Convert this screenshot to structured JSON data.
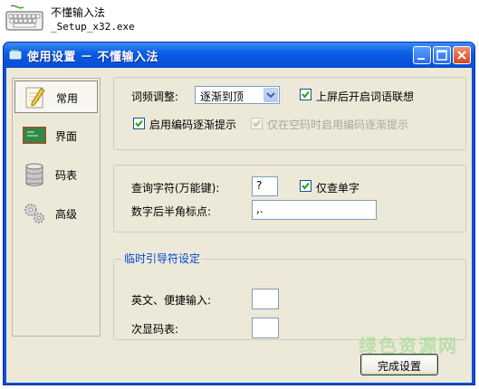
{
  "file": {
    "name_line1": "不懂输入法",
    "name_line2": "_Setup_x32.exe"
  },
  "window": {
    "title": "使用设置 － 不懂输入法"
  },
  "nav": {
    "items": [
      {
        "label": "常用",
        "icon": "pencil-notepad-icon",
        "selected": true
      },
      {
        "label": "界面",
        "icon": "chalkboard-icon",
        "selected": false
      },
      {
        "label": "码表",
        "icon": "database-icon",
        "selected": false
      },
      {
        "label": "高级",
        "icon": "gears-icon",
        "selected": false
      }
    ]
  },
  "general": {
    "freq_label": "词频调整:",
    "freq_value": "逐渐到顶",
    "assoc_label": "上屏后开启词语联想",
    "assoc_checked": true,
    "hint_label": "启用编码逐渐提示",
    "hint_checked": true,
    "hint_space_label": "仅在空码时启用编码逐渐提示",
    "hint_space_checked": true,
    "hint_space_enabled": false
  },
  "query": {
    "wildcard_label": "查询字符(万能键):",
    "wildcard_value": "?",
    "single_char_label": "仅查单字",
    "single_char_checked": true,
    "halfwidth_label": "数字后半角标点:",
    "halfwidth_value": ",."
  },
  "guide": {
    "legend": "临时引导符设定",
    "en_label": "英文、便捷输入:",
    "en_value": "",
    "secondary_label": "次显码表:",
    "secondary_value": ""
  },
  "footer": {
    "done_label": "完成设置"
  },
  "watermark": "绿色资源网",
  "colors": {
    "titlebar": "#0b5fe6",
    "legend_text": "#0046d5",
    "dialog_bg": "#ece9d8"
  }
}
